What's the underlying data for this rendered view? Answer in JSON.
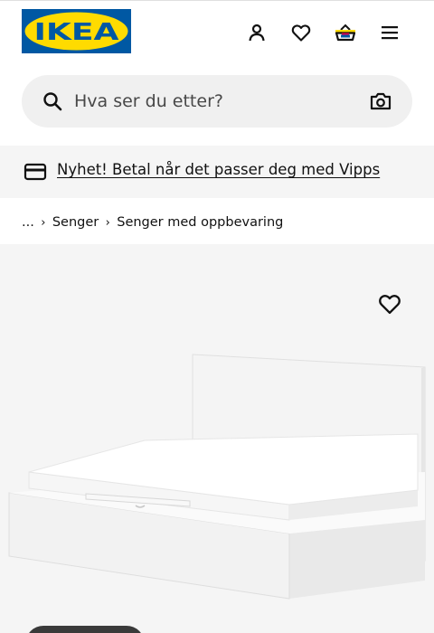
{
  "header": {
    "logo_text": "IKEA",
    "icons": [
      "user-icon",
      "heart-icon",
      "basket-icon",
      "menu-icon"
    ]
  },
  "search": {
    "placeholder": "Hva ser du etter?"
  },
  "banner": {
    "text": "Nyhet! Betal når det passer deg med Vipps"
  },
  "breadcrumb": {
    "items": [
      "...",
      "Senger",
      "Senger med oppbevaring"
    ]
  },
  "colors": {
    "brand_blue": "#0058a3",
    "brand_yellow": "#ffdb00",
    "search_bg": "#f0f0f0",
    "banner_bg": "#f5f5f5",
    "product_bg": "#f5f5f5"
  }
}
